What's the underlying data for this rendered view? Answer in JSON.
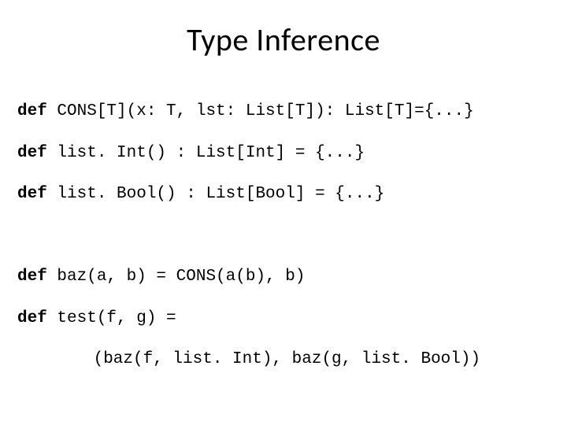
{
  "title": "Type Inference",
  "code": {
    "kw": "def",
    "line1_rest": " CONS[T](x: T, lst: List[T]): List[T]={...}",
    "line2_rest": " list. Int() : List[Int] = {...}",
    "line3_rest": " list. Bool() : List[Bool] = {...}",
    "line4_rest": " baz(a, b) = CONS(a(b), b)",
    "line5_rest": " test(f, g) =",
    "line6": "(baz(f, list. Int), baz(g, list. Bool))"
  }
}
